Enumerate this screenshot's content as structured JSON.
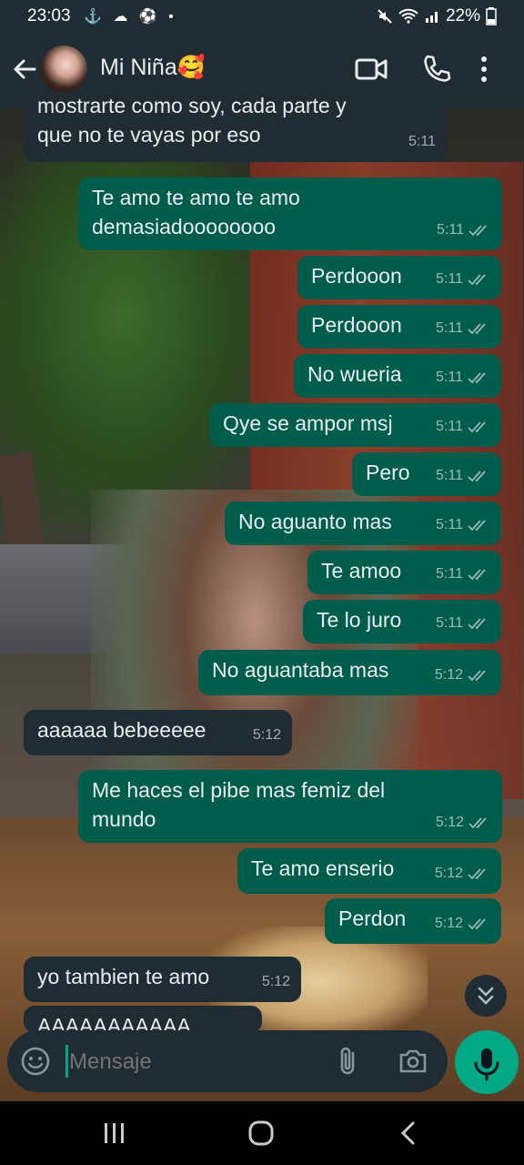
{
  "status_bar": {
    "time": "23:03",
    "left_icons": "⚓ ☁ ⚽ •",
    "battery": "22%"
  },
  "header": {
    "contact_name": "Mi Niña🥰"
  },
  "messages": [
    {
      "dir": "in",
      "lines": [
        "mostrarte como soy, cada parte y",
        "que no te vayas por eso"
      ],
      "time": "5:11"
    },
    {
      "dir": "out",
      "lines": [
        "Te amo te amo te amo",
        "demasiadoooooooo"
      ],
      "time": "5:11"
    },
    {
      "dir": "out",
      "lines": [
        "Perdooon"
      ],
      "time": "5:11"
    },
    {
      "dir": "out",
      "lines": [
        "Perdooon"
      ],
      "time": "5:11"
    },
    {
      "dir": "out",
      "lines": [
        "No wueria"
      ],
      "time": "5:11"
    },
    {
      "dir": "out",
      "lines": [
        "Qye se ampor msj"
      ],
      "time": "5:11"
    },
    {
      "dir": "out",
      "lines": [
        "Pero"
      ],
      "time": "5:11"
    },
    {
      "dir": "out",
      "lines": [
        "No aguanto mas"
      ],
      "time": "5:11"
    },
    {
      "dir": "out",
      "lines": [
        "Te amoo"
      ],
      "time": "5:11"
    },
    {
      "dir": "out",
      "lines": [
        "Te lo juro"
      ],
      "time": "5:11"
    },
    {
      "dir": "out",
      "lines": [
        "No aguantaba mas"
      ],
      "time": "5:12"
    },
    {
      "dir": "in",
      "lines": [
        "aaaaaa bebeeeee"
      ],
      "time": "5:12"
    },
    {
      "dir": "out",
      "lines": [
        "Me haces el pibe mas femiz del",
        "mundo"
      ],
      "time": "5:12"
    },
    {
      "dir": "out",
      "lines": [
        "Te amo enserio"
      ],
      "time": "5:12"
    },
    {
      "dir": "out",
      "lines": [
        "Perdon"
      ],
      "time": "5:12"
    },
    {
      "dir": "in",
      "lines": [
        "yo tambien te amo"
      ],
      "time": "5:12"
    },
    {
      "dir": "in",
      "lines": [
        "AAAAAAAAAAA"
      ],
      "time": ""
    }
  ],
  "composer": {
    "placeholder": "Mensaje"
  },
  "colors": {
    "outgoing": "#005c4b",
    "incoming": "#202c33",
    "accent": "#00a884",
    "header": "#1f2c34"
  }
}
